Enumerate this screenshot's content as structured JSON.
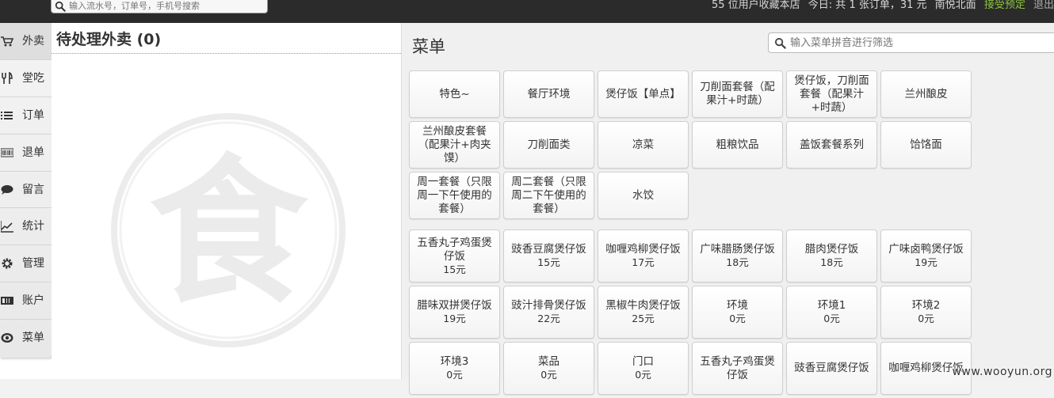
{
  "topbar": {
    "search_placeholder": "输入流水号，订单号，手机号搜索",
    "favorites": "55 位用户收藏本店",
    "today": "今日: 共 1 张订单，31 元",
    "store": "南悦北面",
    "accept": "接受预定",
    "logout": "退出",
    "accept_color": "#8cc63f"
  },
  "sidebar": {
    "items": [
      {
        "label": "外卖",
        "icon": "cart-icon"
      },
      {
        "label": "堂吃",
        "icon": "fork-knife-icon"
      },
      {
        "label": "订单",
        "icon": "list-icon"
      },
      {
        "label": "退单",
        "icon": "barcode-icon"
      },
      {
        "label": "留言",
        "icon": "speech-bubble-icon"
      },
      {
        "label": "统计",
        "icon": "line-chart-icon"
      },
      {
        "label": "管理",
        "icon": "gear-icon"
      },
      {
        "label": "账户",
        "icon": "wallet-icon"
      },
      {
        "label": "菜单",
        "icon": "eye-icon"
      }
    ]
  },
  "orders": {
    "title": "待处理外卖 (0)",
    "watermark_glyph": "食"
  },
  "menu": {
    "title": "菜单",
    "filter_placeholder": "输入菜单拼音进行筛选",
    "categories": [
      "特色~",
      "餐厅环境",
      "煲仔饭【单点】",
      "刀削面套餐（配果汁+时蔬）",
      "煲仔饭，刀削面套餐（配果汁+时蔬）",
      "兰州酿皮",
      "兰州酿皮套餐（配果汁+肉夹馍）",
      "刀削面类",
      "凉菜",
      "粗粮饮品",
      "盖饭套餐系列",
      "饸饹面",
      "周一套餐（只限周一下午使用的套餐）",
      "周二套餐（只限周二下午使用的套餐）",
      "水饺"
    ],
    "dishes": [
      {
        "name": "五香丸子鸡蛋煲仔饭",
        "price": "15元"
      },
      {
        "name": "豉香豆腐煲仔饭",
        "price": "15元"
      },
      {
        "name": "咖喱鸡柳煲仔饭",
        "price": "17元"
      },
      {
        "name": "广味腊肠煲仔饭",
        "price": "18元"
      },
      {
        "name": "腊肉煲仔饭",
        "price": "18元"
      },
      {
        "name": "广味卤鸭煲仔饭",
        "price": "19元"
      },
      {
        "name": "腊味双拼煲仔饭",
        "price": "19元"
      },
      {
        "name": "豉汁排骨煲仔饭",
        "price": "22元"
      },
      {
        "name": "黑椒牛肉煲仔饭",
        "price": "25元"
      },
      {
        "name": "环境",
        "price": "0元"
      },
      {
        "name": "环境1",
        "price": "0元"
      },
      {
        "name": "环境2",
        "price": "0元"
      },
      {
        "name": "环境3",
        "price": "0元"
      },
      {
        "name": "菜品",
        "price": "0元"
      },
      {
        "name": "门口",
        "price": "0元"
      },
      {
        "name": "五香丸子鸡蛋煲仔饭",
        "price": ""
      },
      {
        "name": "豉香豆腐煲仔饭",
        "price": ""
      },
      {
        "name": "咖喱鸡柳煲仔饭",
        "price": ""
      }
    ]
  },
  "watermark": "www.wooyun.org"
}
